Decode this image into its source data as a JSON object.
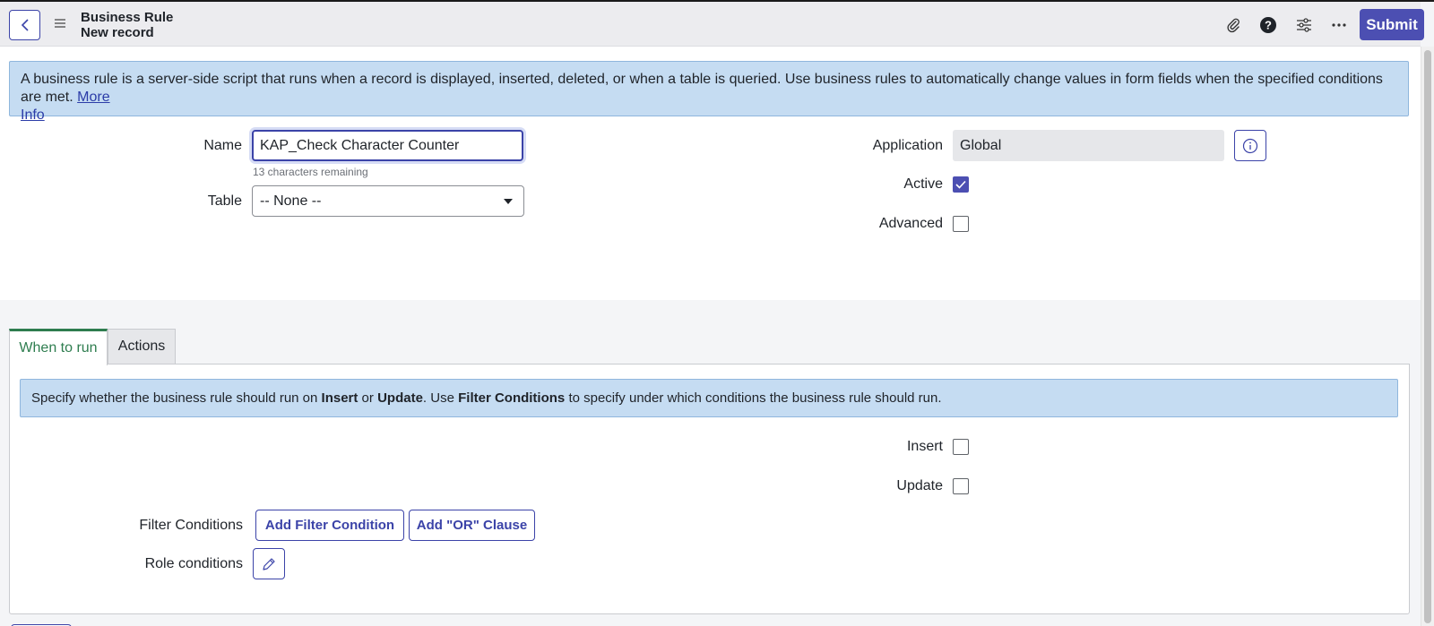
{
  "header": {
    "title": "Business Rule",
    "subtitle": "New record",
    "submit_label": "Submit",
    "icons": [
      "chevron-left-icon",
      "menu-icon",
      "paperclip-icon",
      "help-icon",
      "sliders-icon",
      "more-icon"
    ]
  },
  "info_banner": {
    "text": "A business rule is a server-side script that runs when a record is displayed, inserted, deleted, or when a table is queried. Use business rules to automatically change values in form fields when the specified conditions are met.",
    "link_text_1": "More",
    "link_text_2": "Info"
  },
  "form": {
    "name_label": "Name",
    "name_value": "KAP_Check Character Counter",
    "chars_remaining": "13 characters remaining",
    "table_label": "Table",
    "table_value": "-- None --",
    "application_label": "Application",
    "application_value": "Global",
    "active_label": "Active",
    "active_checked": true,
    "advanced_label": "Advanced",
    "advanced_checked": false
  },
  "tabs": [
    {
      "label": "When to run",
      "active": true
    },
    {
      "label": "Actions",
      "active": false
    }
  ],
  "when_to_run": {
    "banner_part1": "Specify whether the business rule should run on ",
    "banner_bold1": "Insert",
    "banner_part2": " or ",
    "banner_bold2": "Update",
    "banner_part3": ". Use ",
    "banner_bold3": "Filter Conditions",
    "banner_part4": " to specify under which conditions the business rule should run.",
    "insert_label": "Insert",
    "insert_checked": false,
    "update_label": "Update",
    "update_checked": false,
    "filter_conditions_label": "Filter Conditions",
    "add_filter_label": "Add Filter Condition",
    "add_or_label": "Add \"OR\" Clause",
    "role_conditions_label": "Role conditions"
  },
  "colors": {
    "accent": "#4c4fb2",
    "link": "#3b43a8",
    "active_tab": "#2e7d4f",
    "banner_bg": "#c5dcf2"
  }
}
